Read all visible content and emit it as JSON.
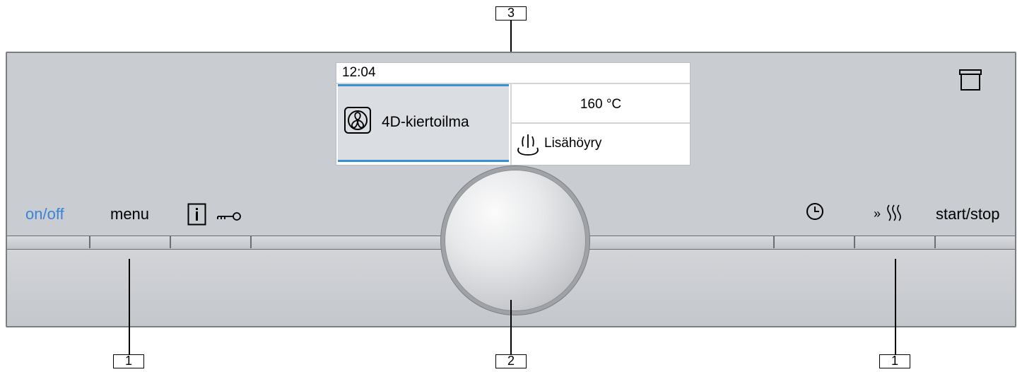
{
  "callouts": {
    "top": "3",
    "bottom_left": "1",
    "bottom_center": "2",
    "bottom_right": "1"
  },
  "buttons": {
    "onoff": "on/off",
    "menu": "menu",
    "info_icon": "info-icon",
    "key_icon": "key-icon",
    "clock_icon": "clock-icon",
    "steam_boost_icon": "steam-boost-icon",
    "startstop": "start/stop"
  },
  "display": {
    "time": "12:04",
    "mode": "4D-kiertoilma",
    "mode_icon": "fan-icon",
    "temperature": "160 °C",
    "steam_icon": "steam-icon",
    "steam": "Lisähöyry"
  },
  "top_right_icon": "oven-door-icon",
  "colors": {
    "onoff_text": "#3a83d6",
    "highlight_bar": "#3a8fd0",
    "panel": "#c9ccd1"
  }
}
